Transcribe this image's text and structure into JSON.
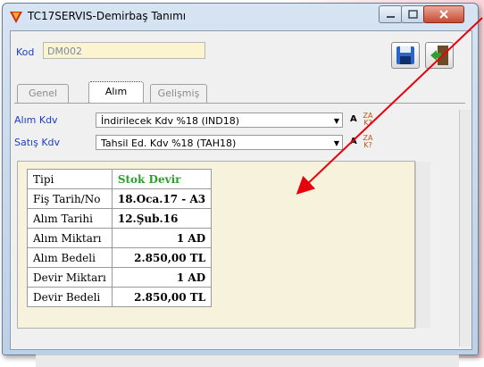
{
  "window": {
    "title": "TC17SERVIS-Demirbaş Tanımı"
  },
  "form": {
    "kod_label": "Kod",
    "kod_value": "DM002"
  },
  "tabs": [
    {
      "label": "Genel"
    },
    {
      "label": "Alım"
    },
    {
      "label": "Gelişmiş"
    }
  ],
  "alim": {
    "alim_kdv_label": "Alım Kdv",
    "alim_kdv_value": "İndirilecek Kdv %18 (IND18)",
    "satis_kdv_label": "Satış Kdv",
    "satis_kdv_value": "Tahsil Ed. Kdv %18 (TAH18)",
    "a_label": "A",
    "za_top": "ZA",
    "za_bottom": "K?"
  },
  "table": {
    "rows": [
      {
        "label": "Tipi",
        "value": "Stok Devir"
      },
      {
        "label": "Fiş Tarih/No",
        "value": "18.Oca.17 - A3"
      },
      {
        "label": "Alım Tarihi",
        "value": "12.Şub.16"
      },
      {
        "label": "Alım Miktarı",
        "value": "1 AD"
      },
      {
        "label": "Alım Bedeli",
        "value": "2.850,00 TL"
      },
      {
        "label": "Devir Miktarı",
        "value": "1 AD"
      },
      {
        "label": "Devir Bedeli",
        "value": "2.850,00 TL"
      }
    ]
  },
  "colors": {
    "arrow": "#e8000b",
    "label_blue": "#1a3fc0",
    "kod_field_bg": "#fcf4cf",
    "grid_bg": "#f6f2dc"
  }
}
